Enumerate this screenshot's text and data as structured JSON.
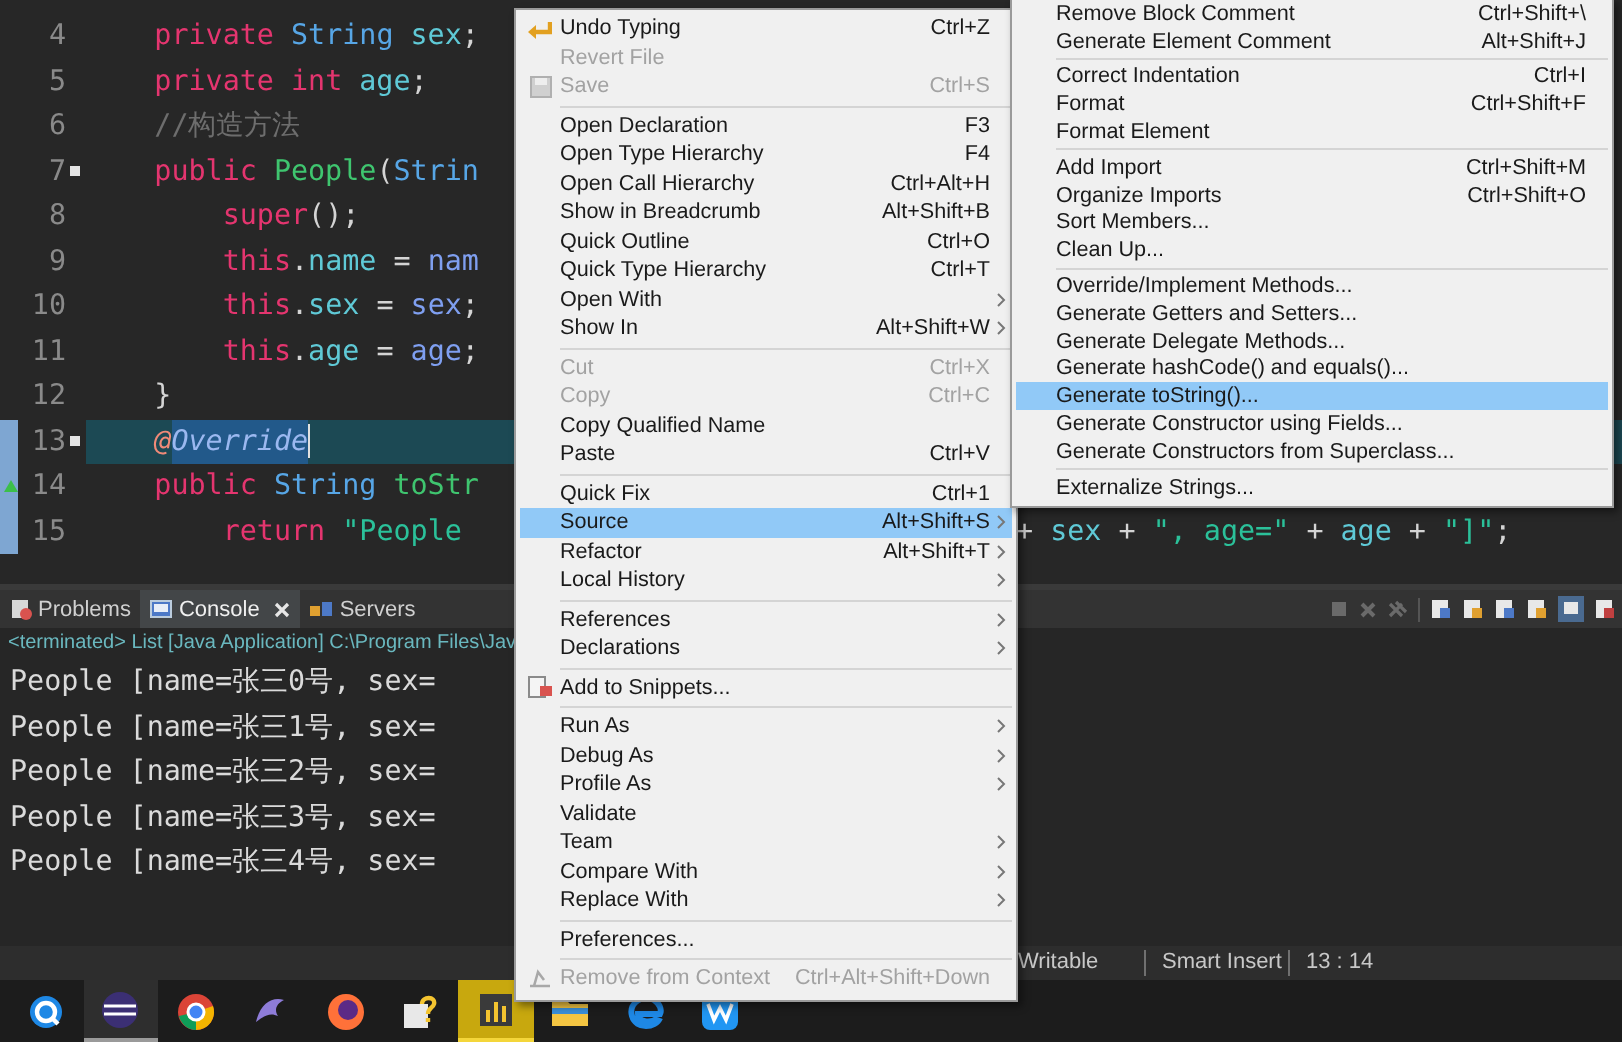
{
  "editor": {
    "lines": [
      {
        "number": "4",
        "kind": "member",
        "fold": false,
        "changed": false,
        "current": false,
        "override": false,
        "tokens": [
          {
            "kind": "keyword",
            "text": "private",
            "space_before": false
          },
          {
            "kind": "type",
            "text": "String",
            "space_before": true
          },
          {
            "kind": "field",
            "text": "sex",
            "space_before": true
          },
          {
            "kind": "plain",
            "text": ";",
            "space_before": false
          }
        ]
      },
      {
        "number": "5",
        "kind": "member",
        "fold": false,
        "changed": false,
        "current": false,
        "override": false,
        "tokens": [
          {
            "kind": "keyword",
            "text": "private",
            "space_before": false
          },
          {
            "kind": "keyword",
            "text": "int",
            "space_before": true
          },
          {
            "kind": "field",
            "text": "age",
            "space_before": true
          },
          {
            "kind": "plain",
            "text": ";",
            "space_before": false
          }
        ]
      },
      {
        "number": "6",
        "kind": "member",
        "fold": false,
        "changed": false,
        "current": false,
        "override": false,
        "tokens": [
          {
            "kind": "comment",
            "text": "//构造方法",
            "space_before": false
          }
        ]
      },
      {
        "number": "7",
        "kind": "member",
        "fold": true,
        "changed": false,
        "current": false,
        "override": false,
        "tokens": [
          {
            "kind": "keyword",
            "text": "public",
            "space_before": false
          },
          {
            "kind": "class",
            "text": "People",
            "space_before": true
          },
          {
            "kind": "plain",
            "text": "(",
            "space_before": false
          },
          {
            "kind": "type",
            "text": "Strin",
            "space_before": false
          }
        ]
      },
      {
        "number": "8",
        "kind": "body",
        "fold": false,
        "changed": false,
        "current": false,
        "override": false,
        "tokens": [
          {
            "kind": "keyword",
            "text": "super",
            "space_before": false
          },
          {
            "kind": "plain",
            "text": "();",
            "space_before": false
          }
        ]
      },
      {
        "number": "9",
        "kind": "body",
        "fold": false,
        "changed": false,
        "current": false,
        "override": false,
        "tokens": [
          {
            "kind": "keyword",
            "text": "this",
            "space_before": false
          },
          {
            "kind": "plain",
            "text": ".",
            "space_before": false
          },
          {
            "kind": "field",
            "text": "name",
            "space_before": false
          },
          {
            "kind": "plain",
            "text": "=",
            "space_before": true
          },
          {
            "kind": "param",
            "text": "nam",
            "space_before": true
          }
        ]
      },
      {
        "number": "10",
        "kind": "body",
        "fold": false,
        "changed": false,
        "current": false,
        "override": false,
        "tokens": [
          {
            "kind": "keyword",
            "text": "this",
            "space_before": false
          },
          {
            "kind": "plain",
            "text": ".",
            "space_before": false
          },
          {
            "kind": "field",
            "text": "sex",
            "space_before": false
          },
          {
            "kind": "plain",
            "text": "=",
            "space_before": true
          },
          {
            "kind": "param",
            "text": "sex",
            "space_before": true
          },
          {
            "kind": "plain",
            "text": ";",
            "space_before": false
          }
        ]
      },
      {
        "number": "11",
        "kind": "body",
        "fold": false,
        "changed": false,
        "current": false,
        "override": false,
        "tokens": [
          {
            "kind": "keyword",
            "text": "this",
            "space_before": false
          },
          {
            "kind": "plain",
            "text": ".",
            "space_before": false
          },
          {
            "kind": "field",
            "text": "age",
            "space_before": false
          },
          {
            "kind": "plain",
            "text": "=",
            "space_before": true
          },
          {
            "kind": "param",
            "text": "age",
            "space_before": true
          },
          {
            "kind": "plain",
            "text": ";",
            "space_before": false
          }
        ]
      },
      {
        "number": "12",
        "kind": "member",
        "fold": false,
        "changed": false,
        "current": false,
        "override": false,
        "tokens": [
          {
            "kind": "plain",
            "text": "}",
            "space_before": false
          }
        ]
      },
      {
        "number": "13",
        "kind": "member",
        "fold": true,
        "changed": true,
        "current": true,
        "override": false,
        "tokens": [
          {
            "kind": "annotation",
            "text": "@",
            "space_before": false
          },
          {
            "kind": "selection",
            "text": "Override",
            "space_before": false
          }
        ]
      },
      {
        "number": "14",
        "kind": "member",
        "fold": false,
        "changed": true,
        "current": false,
        "override": true,
        "tokens": [
          {
            "kind": "keyword",
            "text": "public",
            "space_before": false
          },
          {
            "kind": "type",
            "text": "String",
            "space_before": true
          },
          {
            "kind": "method",
            "text": "toStr",
            "space_before": true
          }
        ]
      },
      {
        "number": "15",
        "kind": "body",
        "fold": false,
        "changed": true,
        "current": false,
        "override": false,
        "tokens": [
          {
            "kind": "keyword",
            "text": "return",
            "space_before": false
          },
          {
            "kind": "string",
            "text": "\"People",
            "space_before": true
          }
        ],
        "tail": [
          {
            "kind": "plain",
            "text": "+",
            "space_before": false
          },
          {
            "kind": "field",
            "text": "sex",
            "space_before": true
          },
          {
            "kind": "plain",
            "text": "+",
            "space_before": true
          },
          {
            "kind": "string",
            "text": "\", age=\"",
            "space_before": true
          },
          {
            "kind": "plain",
            "text": "+",
            "space_before": true
          },
          {
            "kind": "field",
            "text": "age",
            "space_before": true
          },
          {
            "kind": "plain",
            "text": "+",
            "space_before": true
          },
          {
            "kind": "string",
            "text": "\"]\"",
            "space_before": true
          },
          {
            "kind": "plain",
            "text": ";",
            "space_before": false
          }
        ]
      }
    ]
  },
  "console": {
    "tabs": [
      {
        "label": "Problems",
        "kind": "problems",
        "selected": false,
        "closable": false
      },
      {
        "label": "Console",
        "kind": "console",
        "selected": true,
        "closable": true
      },
      {
        "label": "Servers",
        "kind": "servers",
        "selected": false,
        "closable": false
      }
    ],
    "header": "<terminated> List [Java Application] C:\\Program Files\\Jav",
    "output": [
      "People [name=张三0号, sex=",
      "People [name=张三1号, sex=",
      "People [name=张三2号, sex=",
      "People [name=张三3号, sex=",
      "People [name=张三4号, sex="
    ]
  },
  "status_bar": {
    "fields": [
      "Writable",
      "Smart Insert",
      "13 : 14"
    ]
  },
  "taskbar": {
    "apps": [
      {
        "kind": "search",
        "active": false,
        "running": false
      },
      {
        "kind": "eclipse",
        "active": false,
        "running": true
      },
      {
        "kind": "chrome",
        "active": false,
        "running": false
      },
      {
        "kind": "dolphin",
        "active": false,
        "running": false
      },
      {
        "kind": "firefox",
        "active": false,
        "running": false
      },
      {
        "kind": "help",
        "active": false,
        "running": false
      },
      {
        "kind": "chart",
        "active": true,
        "running": true
      },
      {
        "kind": "folder",
        "active": false,
        "running": false
      },
      {
        "kind": "edge",
        "active": false,
        "running": false
      },
      {
        "kind": "wps",
        "active": false,
        "running": false
      }
    ]
  },
  "context_menu": {
    "items": [
      {
        "kind": "undo",
        "label": "Undo Typing",
        "shortcut": "Ctrl+Z",
        "disabled": false,
        "has_submenu": false,
        "selected": false
      },
      {
        "kind": "plain",
        "label": "Revert File",
        "disabled": true,
        "has_submenu": false,
        "selected": false
      },
      {
        "kind": "save",
        "label": "Save",
        "shortcut": "Ctrl+S",
        "disabled": true,
        "has_submenu": false,
        "selected": false
      },
      {
        "kind": "separator"
      },
      {
        "kind": "plain",
        "label": "Open Declaration",
        "shortcut": "F3",
        "disabled": false,
        "has_submenu": false,
        "selected": false
      },
      {
        "kind": "plain",
        "label": "Open Type Hierarchy",
        "shortcut": "F4",
        "disabled": false,
        "has_submenu": false,
        "selected": false
      },
      {
        "kind": "plain",
        "label": "Open Call Hierarchy",
        "shortcut": "Ctrl+Alt+H",
        "disabled": false,
        "has_submenu": false,
        "selected": false
      },
      {
        "kind": "plain",
        "label": "Show in Breadcrumb",
        "shortcut": "Alt+Shift+B",
        "disabled": false,
        "has_submenu": false,
        "selected": false
      },
      {
        "kind": "plain",
        "label": "Quick Outline",
        "shortcut": "Ctrl+O",
        "disabled": false,
        "has_submenu": false,
        "selected": false
      },
      {
        "kind": "plain",
        "label": "Quick Type Hierarchy",
        "shortcut": "Ctrl+T",
        "disabled": false,
        "has_submenu": false,
        "selected": false
      },
      {
        "kind": "plain",
        "label": "Open With",
        "disabled": false,
        "has_submenu": true,
        "selected": false
      },
      {
        "kind": "plain",
        "label": "Show In",
        "shortcut": "Alt+Shift+W",
        "disabled": false,
        "has_submenu": true,
        "selected": false
      },
      {
        "kind": "separator"
      },
      {
        "kind": "plain",
        "label": "Cut",
        "shortcut": "Ctrl+X",
        "disabled": true,
        "has_submenu": false,
        "selected": false
      },
      {
        "kind": "plain",
        "label": "Copy",
        "shortcut": "Ctrl+C",
        "disabled": true,
        "has_submenu": false,
        "selected": false
      },
      {
        "kind": "plain",
        "label": "Copy Qualified Name",
        "disabled": false,
        "has_submenu": false,
        "selected": false
      },
      {
        "kind": "plain",
        "label": "Paste",
        "shortcut": "Ctrl+V",
        "disabled": false,
        "has_submenu": false,
        "selected": false
      },
      {
        "kind": "separator"
      },
      {
        "kind": "plain",
        "label": "Quick Fix",
        "shortcut": "Ctrl+1",
        "disabled": false,
        "has_submenu": false,
        "selected": false
      },
      {
        "kind": "plain",
        "label": "Source",
        "shortcut": "Alt+Shift+S",
        "disabled": false,
        "has_submenu": true,
        "selected": true
      },
      {
        "kind": "plain",
        "label": "Refactor",
        "shortcut": "Alt+Shift+T",
        "disabled": false,
        "has_submenu": true,
        "selected": false
      },
      {
        "kind": "plain",
        "label": "Local History",
        "disabled": false,
        "has_submenu": true,
        "selected": false
      },
      {
        "kind": "separator"
      },
      {
        "kind": "plain",
        "label": "References",
        "disabled": false,
        "has_submenu": true,
        "selected": false
      },
      {
        "kind": "plain",
        "label": "Declarations",
        "disabled": false,
        "has_submenu": true,
        "selected": false
      },
      {
        "kind": "separator"
      },
      {
        "kind": "snippet",
        "label": "Add to Snippets...",
        "disabled": false,
        "has_submenu": false,
        "selected": false
      },
      {
        "kind": "separator"
      },
      {
        "kind": "plain",
        "label": "Run As",
        "disabled": false,
        "has_submenu": true,
        "selected": false
      },
      {
        "kind": "plain",
        "label": "Debug As",
        "disabled": false,
        "has_submenu": true,
        "selected": false
      },
      {
        "kind": "plain",
        "label": "Profile As",
        "disabled": false,
        "has_submenu": true,
        "selected": false
      },
      {
        "kind": "plain",
        "label": "Validate",
        "disabled": false,
        "has_submenu": false,
        "selected": false
      },
      {
        "kind": "plain",
        "label": "Team",
        "disabled": false,
        "has_submenu": true,
        "selected": false
      },
      {
        "kind": "plain",
        "label": "Compare With",
        "disabled": false,
        "has_submenu": true,
        "selected": false
      },
      {
        "kind": "plain",
        "label": "Replace With",
        "disabled": false,
        "has_submenu": true,
        "selected": false
      },
      {
        "kind": "separator"
      },
      {
        "kind": "plain",
        "label": "Preferences...",
        "disabled": false,
        "has_submenu": false,
        "selected": false
      },
      {
        "kind": "separator"
      },
      {
        "kind": "context",
        "label": "Remove from Context",
        "shortcut": "Ctrl+Alt+Shift+Down",
        "disabled": true,
        "has_submenu": false,
        "selected": false
      }
    ]
  },
  "submenu": {
    "items": [
      {
        "kind": "plain",
        "label": "Remove Block Comment",
        "shortcut": "Ctrl+Shift+\\",
        "selected": false
      },
      {
        "kind": "plain",
        "label": "Generate Element Comment",
        "shortcut": "Alt+Shift+J",
        "selected": false
      },
      {
        "kind": "separator"
      },
      {
        "kind": "plain",
        "label": "Correct Indentation",
        "shortcut": "Ctrl+I",
        "selected": false
      },
      {
        "kind": "plain",
        "label": "Format",
        "shortcut": "Ctrl+Shift+F",
        "selected": false
      },
      {
        "kind": "plain",
        "label": "Format Element",
        "selected": false
      },
      {
        "kind": "separator"
      },
      {
        "kind": "plain",
        "label": "Add Import",
        "shortcut": "Ctrl+Shift+M",
        "selected": false
      },
      {
        "kind": "plain",
        "label": "Organize Imports",
        "shortcut": "Ctrl+Shift+O",
        "selected": false
      },
      {
        "kind": "plain",
        "label": "Sort Members...",
        "selected": false
      },
      {
        "kind": "plain",
        "label": "Clean Up...",
        "selected": false
      },
      {
        "kind": "separator"
      },
      {
        "kind": "plain",
        "label": "Override/Implement Methods...",
        "selected": false
      },
      {
        "kind": "plain",
        "label": "Generate Getters and Setters...",
        "selected": false
      },
      {
        "kind": "plain",
        "label": "Generate Delegate Methods...",
        "selected": false
      },
      {
        "kind": "plain",
        "label": "Generate hashCode() and equals()...",
        "selected": false
      },
      {
        "kind": "plain",
        "label": "Generate toString()...",
        "selected": true
      },
      {
        "kind": "plain",
        "label": "Generate Constructor using Fields...",
        "selected": false
      },
      {
        "kind": "plain",
        "label": "Generate Constructors from Superclass...",
        "selected": false
      },
      {
        "kind": "separator"
      },
      {
        "kind": "plain",
        "label": "Externalize Strings...",
        "selected": false
      }
    ]
  }
}
